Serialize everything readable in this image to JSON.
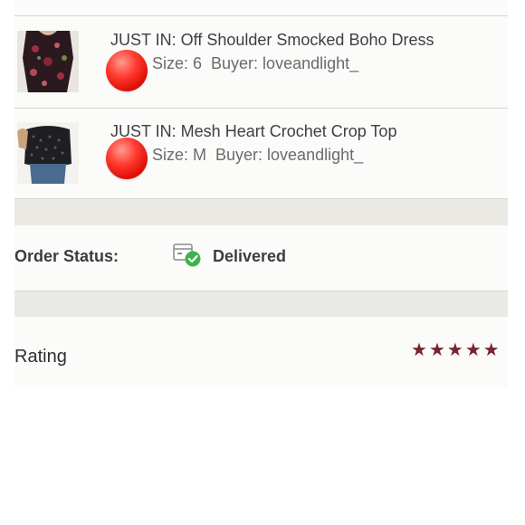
{
  "items": [
    {
      "title": "JUST IN: Off Shoulder Smocked Boho Dress",
      "size": "Size: 6",
      "buyer": "Buyer: loveandlight_",
      "thumbnail": "floral-dress-photo"
    },
    {
      "title": "JUST IN: Mesh Heart Crochet Crop Top",
      "size": "Size: M",
      "buyer": "Buyer: loveandlight_",
      "thumbnail": "mesh-top-photo"
    }
  ],
  "order_status": {
    "label": "Order Status:",
    "value": "Delivered",
    "icon": "package-delivered-icon"
  },
  "rating": {
    "label": "Rating",
    "stars": 5,
    "max_stars": 5,
    "star_color": "#7a2430"
  },
  "colors": {
    "accent_red": "#ff3b30",
    "check_green": "#3cb44b"
  }
}
